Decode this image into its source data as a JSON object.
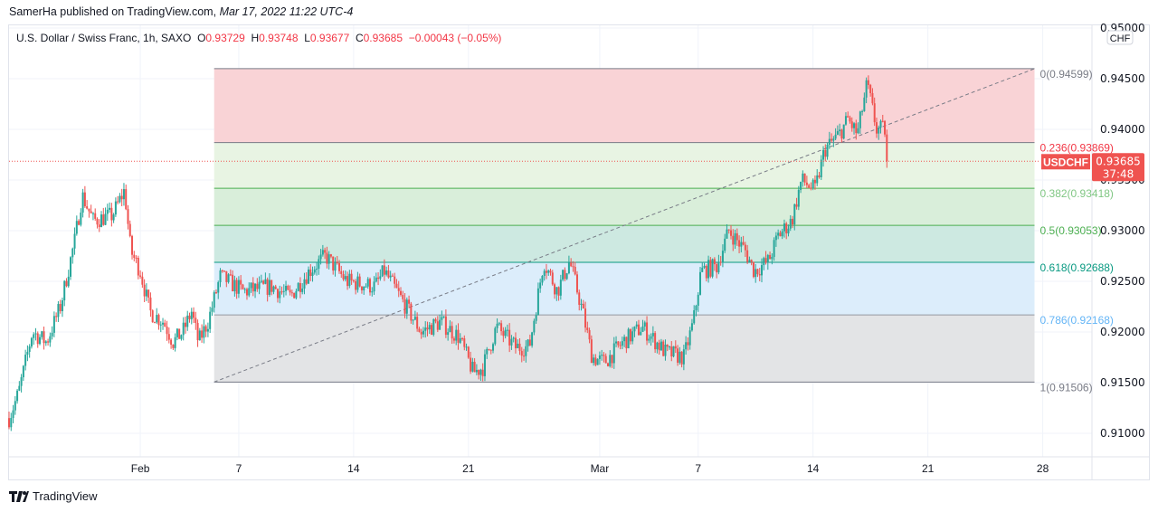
{
  "header": {
    "publisher": "SamerHa published on TradingView.com,",
    "date": "Mar 17, 2022 11:22 UTC-4"
  },
  "legend": {
    "symbol": "U.S. Dollar / Swiss Franc, 1h, SAXO",
    "o_label": "O",
    "o": "0.93729",
    "h_label": "H",
    "h": "0.93748",
    "l_label": "L",
    "l": "0.93677",
    "c_label": "C",
    "c": "0.93685",
    "change": "−0.00043 (−0.05%)"
  },
  "brand": "TradingView",
  "colors": {
    "up": "#26a69a",
    "down": "#ef5350",
    "price_tag": "#ef5350"
  },
  "chart_data": {
    "type": "candlestick",
    "currency": "CHF",
    "yticks": [
      0.95,
      0.945,
      0.94,
      0.935,
      0.93,
      0.925,
      0.92,
      0.915,
      0.91
    ],
    "ytick_labels": [
      "0.95000",
      "0.94500",
      "0.94000",
      "0.93500",
      "0.93000",
      "0.92500",
      "0.92000",
      "0.91500",
      "0.91000"
    ],
    "ylim": [
      0.9078,
      0.9503
    ],
    "xlim": [
      "2022-01-24T00",
      "2022-03-31T00"
    ],
    "xticks": [
      {
        "date": "2022-02-01",
        "label": "Feb"
      },
      {
        "date": "2022-02-07",
        "label": "7"
      },
      {
        "date": "2022-02-14",
        "label": "14"
      },
      {
        "date": "2022-02-21",
        "label": "21"
      },
      {
        "date": "2022-03-01",
        "label": "Mar"
      },
      {
        "date": "2022-03-07",
        "label": "7"
      },
      {
        "date": "2022-03-14",
        "label": "14"
      },
      {
        "date": "2022-03-21",
        "label": "21"
      },
      {
        "date": "2022-03-28",
        "label": "28"
      }
    ],
    "price_path": [
      [
        "2022-01-24T00",
        0.9115
      ],
      [
        "2022-01-24T14",
        0.914
      ],
      [
        "2022-01-25T10",
        0.92
      ],
      [
        "2022-01-26T07",
        0.919
      ],
      [
        "2022-01-27T03",
        0.9225
      ],
      [
        "2022-01-28T00",
        0.929
      ],
      [
        "2022-01-28T11",
        0.9335
      ],
      [
        "2022-01-29T03",
        0.931
      ],
      [
        "2022-01-30T07",
        0.9315
      ],
      [
        "2022-01-31T01",
        0.934
      ],
      [
        "2022-01-31T10",
        0.928
      ],
      [
        "2022-02-01T00",
        0.926
      ],
      [
        "2022-02-01T14",
        0.922
      ],
      [
        "2022-02-02T10",
        0.921
      ],
      [
        "2022-02-03T00",
        0.919
      ],
      [
        "2022-02-03T14",
        0.92
      ],
      [
        "2022-02-04T03",
        0.922
      ],
      [
        "2022-02-04T13",
        0.919
      ],
      [
        "2022-02-05T03",
        0.921
      ],
      [
        "2022-02-05T21",
        0.9255
      ],
      [
        "2022-02-07T07",
        0.924
      ],
      [
        "2022-02-09T00",
        0.9245
      ],
      [
        "2022-02-10T03",
        0.9235
      ],
      [
        "2022-02-11T07",
        0.926
      ],
      [
        "2022-02-12T07",
        0.9275
      ],
      [
        "2022-02-13T14",
        0.925
      ],
      [
        "2022-02-15T07",
        0.9245
      ],
      [
        "2022-02-15T21",
        0.926
      ],
      [
        "2022-02-17T00",
        0.923
      ],
      [
        "2022-02-18T03",
        0.92
      ],
      [
        "2022-02-19T07",
        0.921
      ],
      [
        "2022-02-20T10",
        0.9195
      ],
      [
        "2022-02-21T07",
        0.916
      ],
      [
        "2022-02-21T21",
        0.9165
      ],
      [
        "2022-02-22T17",
        0.9205
      ],
      [
        "2022-02-23T21",
        0.9185
      ],
      [
        "2022-02-24T17",
        0.9185
      ],
      [
        "2022-02-25T14",
        0.927
      ],
      [
        "2022-02-26T10",
        0.924
      ],
      [
        "2022-02-27T04",
        0.927
      ],
      [
        "2022-02-27T23",
        0.922
      ],
      [
        "2022-02-28T13",
        0.9175
      ],
      [
        "2022-03-01T07",
        0.917
      ],
      [
        "2022-03-02T10",
        0.919
      ],
      [
        "2022-03-03T14",
        0.9205
      ],
      [
        "2022-03-05T00",
        0.918
      ],
      [
        "2022-03-06T03",
        0.9175
      ],
      [
        "2022-03-06T17",
        0.921
      ],
      [
        "2022-03-07T04",
        0.926
      ],
      [
        "2022-03-08T03",
        0.9265
      ],
      [
        "2022-03-08T21",
        0.93
      ],
      [
        "2022-03-09T21",
        0.928
      ],
      [
        "2022-03-10T10",
        0.926
      ],
      [
        "2022-03-11T07",
        0.927
      ],
      [
        "2022-03-11T21",
        0.9295
      ],
      [
        "2022-03-12T17",
        0.931
      ],
      [
        "2022-03-13T07",
        0.935
      ],
      [
        "2022-03-14T03",
        0.934
      ],
      [
        "2022-03-14T17",
        0.938
      ],
      [
        "2022-03-15T14",
        0.9395
      ],
      [
        "2022-03-16T03",
        0.941
      ],
      [
        "2022-03-16T17",
        0.9395
      ],
      [
        "2022-03-17T07",
        0.9445
      ],
      [
        "2022-03-17T21",
        0.94
      ],
      [
        "2022-03-18T10",
        0.94
      ],
      [
        "2022-03-18T14",
        0.93685
      ]
    ],
    "fib": {
      "start": [
        "2022-02-05T12",
        0.91506
      ],
      "end": [
        "2022-03-27T12",
        0.94599
      ],
      "levels": [
        {
          "ratio": "0",
          "price": 0.94599,
          "label": "0(0.94599)",
          "line": "#787b86",
          "fill": "#f9d3d6",
          "text": "#787b86"
        },
        {
          "ratio": "0.236",
          "price": 0.93869,
          "label": "0.236(0.93869)",
          "line": "#787b86",
          "fill": "#e8f4e3",
          "text": "#f23645"
        },
        {
          "ratio": "0.382",
          "price": 0.93418,
          "label": "0.382(0.93418)",
          "line": "#4caf50",
          "fill": "#d9eeda",
          "text": "#81c784"
        },
        {
          "ratio": "0.5",
          "price": 0.93053,
          "label": "0.5(0.93053)",
          "line": "#4caf50",
          "fill": "#cde9e1",
          "text": "#4caf50"
        },
        {
          "ratio": "0.618",
          "price": 0.92688,
          "label": "0.618(0.92688)",
          "line": "#089981",
          "fill": "#dcedfb",
          "text": "#089981"
        },
        {
          "ratio": "0.786",
          "price": 0.92168,
          "label": "0.786(0.92168)",
          "line": "#9598a1",
          "fill": "#e3e4e6",
          "text": "#64b5f6"
        },
        {
          "ratio": "1",
          "price": 0.91506,
          "label": "1(0.91506)",
          "line": "#787b86",
          "fill": null,
          "text": "#787b86"
        }
      ]
    },
    "last_price": {
      "symbol": "USDCHF",
      "value": "0.93685",
      "countdown": "37:48",
      "price": 0.93685
    }
  }
}
